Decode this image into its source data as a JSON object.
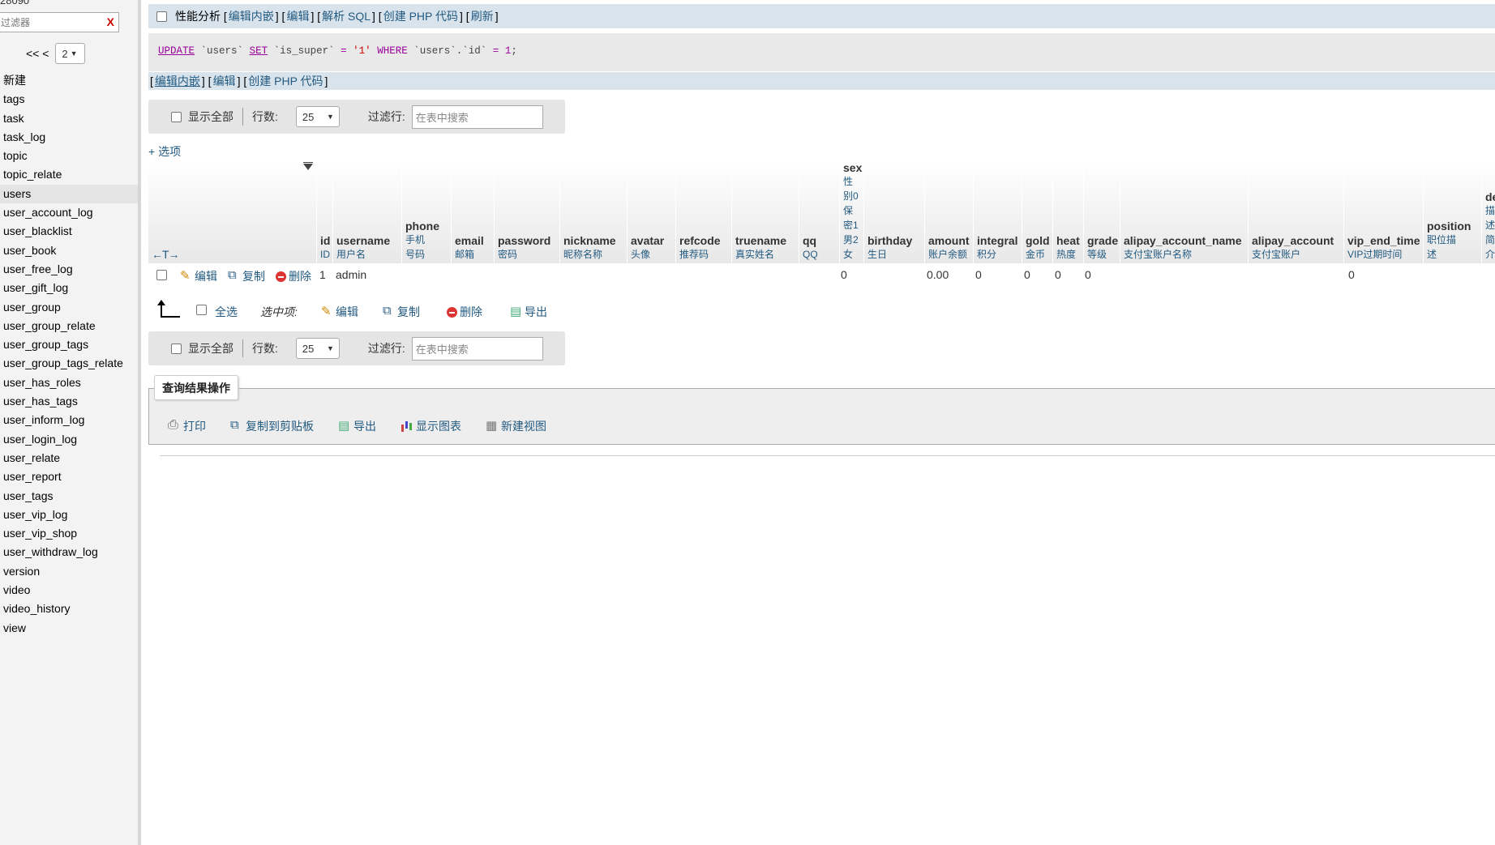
{
  "nav": {
    "db_name": "28090",
    "filter_placeholder": "过滤器",
    "filter_clear": "X",
    "pager_prev": "<< <",
    "pager_page": "2",
    "items": [
      "新建",
      "tags",
      "task",
      "task_log",
      "topic",
      "topic_relate",
      "users",
      "user_account_log",
      "user_blacklist",
      "user_book",
      "user_free_log",
      "user_gift_log",
      "user_group",
      "user_group_relate",
      "user_group_tags",
      "user_group_tags_relate",
      "user_has_roles",
      "user_has_tags",
      "user_inform_log",
      "user_login_log",
      "user_relate",
      "user_report",
      "user_tags",
      "user_vip_log",
      "user_vip_shop",
      "user_withdraw_log",
      "version",
      "video",
      "video_history",
      "view"
    ],
    "active_item": "users"
  },
  "query_bar": {
    "profiling": "性能分析",
    "links": [
      "编辑内嵌",
      "编辑",
      "解析 SQL",
      "创建 PHP 代码",
      "刷新"
    ]
  },
  "sql": {
    "kw_update": "UPDATE",
    "table": "`users`",
    "kw_set": "SET",
    "column": "`is_super`",
    "eq": "=",
    "value": "'1'",
    "kw_where": "WHERE",
    "cond_table": "`users`",
    "dot": ".",
    "cond_col": "`id`",
    "eq2": "=",
    "cond_value": "1",
    "semicolon": ";"
  },
  "query_bar2": {
    "links": [
      "编辑内嵌",
      "编辑",
      "创建 PHP 代码"
    ]
  },
  "navbox": {
    "show_all": "显示全部",
    "rows_label": "行数:",
    "rows_value": "25",
    "filter_label": "过滤行:",
    "filter_placeholder": "在表中搜索"
  },
  "options_link": "+ 选项",
  "table": {
    "arrows": "←T→",
    "columns": [
      {
        "name": "id",
        "comment": "ID"
      },
      {
        "name": "username",
        "comment": "用户名"
      },
      {
        "name": "phone",
        "comment": "手机\n号码"
      },
      {
        "name": "email",
        "comment": "邮箱"
      },
      {
        "name": "password",
        "comment": "密码"
      },
      {
        "name": "nickname",
        "comment": "昵称名称"
      },
      {
        "name": "avatar",
        "comment": "头像"
      },
      {
        "name": "refcode",
        "comment": "推荐码"
      },
      {
        "name": "truename",
        "comment": "真实姓名"
      },
      {
        "name": "qq",
        "comment": "QQ"
      },
      {
        "name": "sex",
        "comment": "性\n别0\n保\n密1\n男2\n女"
      },
      {
        "name": "birthday",
        "comment": "生日"
      },
      {
        "name": "amount",
        "comment": "账户余额"
      },
      {
        "name": "integral",
        "comment": "积分"
      },
      {
        "name": "gold",
        "comment": "金币"
      },
      {
        "name": "heat",
        "comment": "热度"
      },
      {
        "name": "grade",
        "comment": "等级"
      },
      {
        "name": "alipay_account_name",
        "comment": "支付宝账户名称"
      },
      {
        "name": "alipay_account",
        "comment": "支付宝账户"
      },
      {
        "name": "vip_end_time",
        "comment": "VIP过期时间"
      },
      {
        "name": "position",
        "comment": "职位描\n述"
      },
      {
        "name": "de",
        "comment": "描\n述\n简\n介"
      }
    ],
    "row_actions": {
      "edit": "编辑",
      "copy": "复制",
      "delete": "删除"
    },
    "row": {
      "id": "1",
      "username": "admin",
      "sex": "0",
      "amount": "0.00",
      "integral": "0",
      "gold": "0",
      "heat": "0",
      "grade": "0",
      "vip_end_time": "0"
    }
  },
  "selection_bar": {
    "select_all": "全选",
    "selected_label": "选中项:",
    "edit": "编辑",
    "copy": "复制",
    "delete": "删除",
    "export": "导出"
  },
  "query_results_ops": {
    "legend": "查询结果操作",
    "items": [
      "打印",
      "复制到剪贴板",
      "导出",
      "显示图表",
      "新建视图"
    ]
  }
}
